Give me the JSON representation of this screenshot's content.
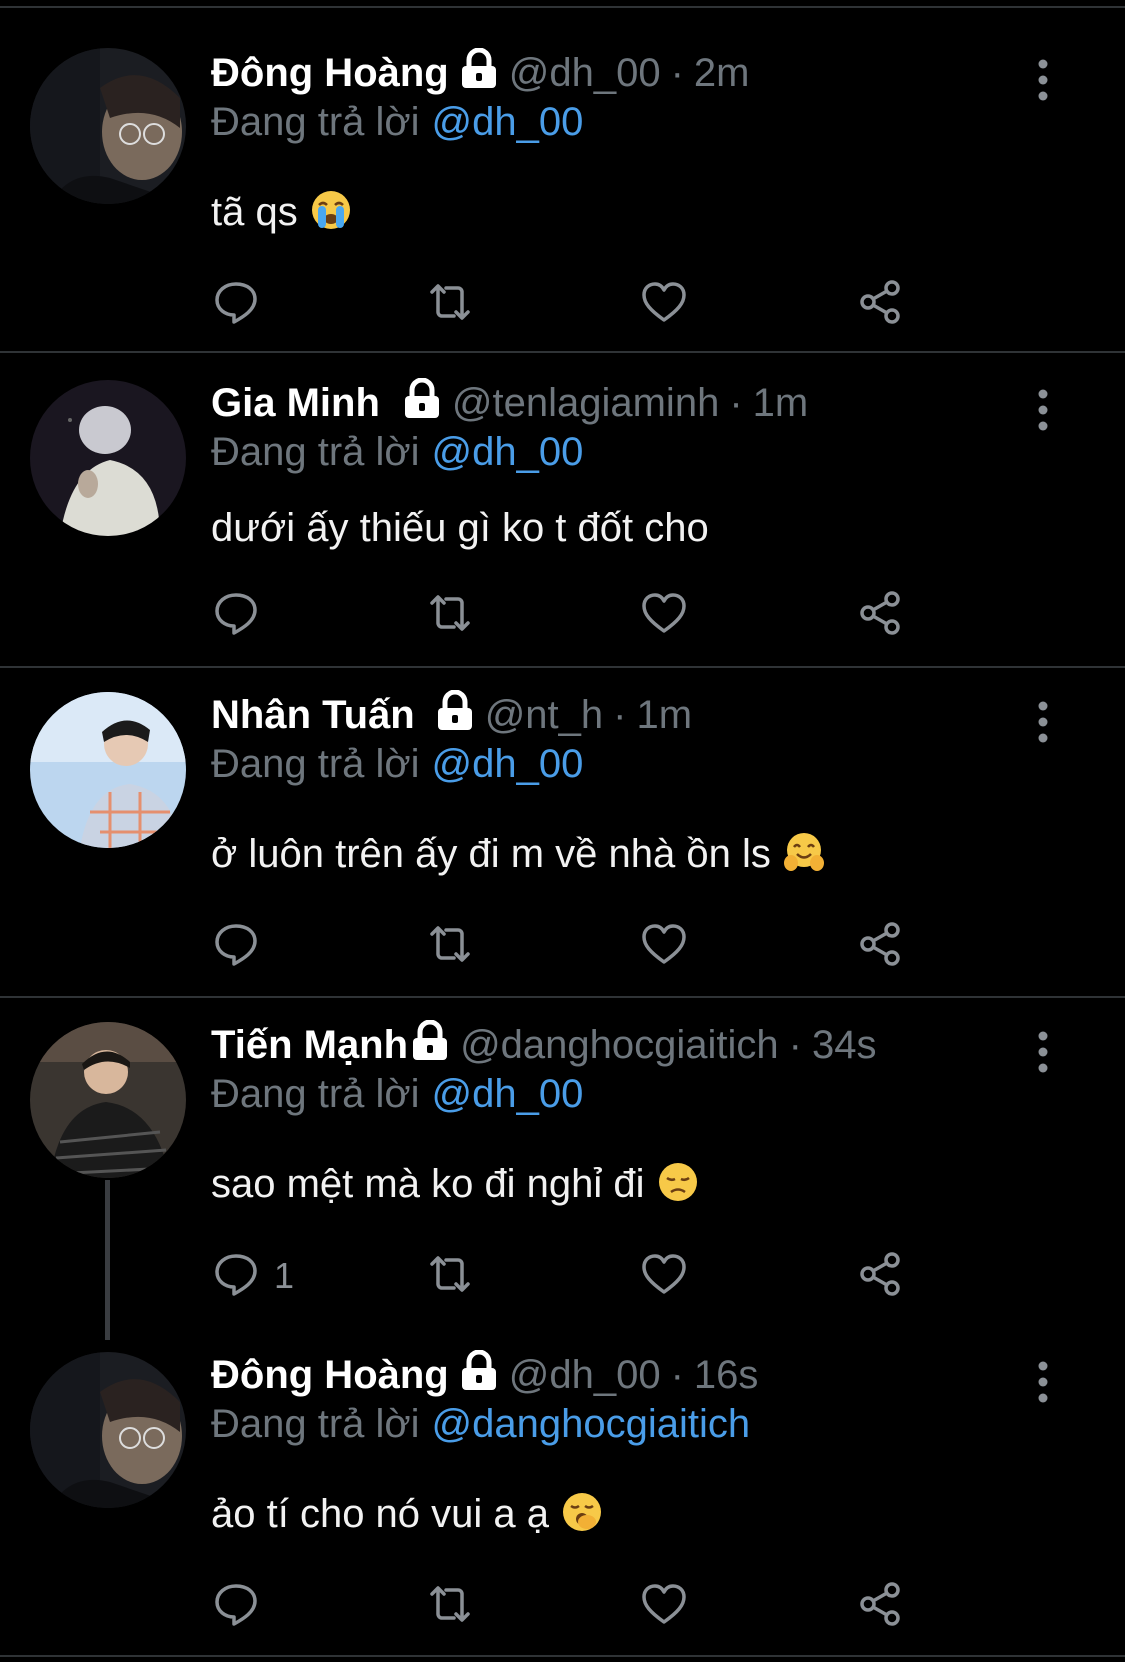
{
  "reply_label": "Đang trả lời",
  "colors": {
    "background": "#000000",
    "mention": "#4a9de8",
    "muted": "#6e767d",
    "divider": "#2f3336"
  },
  "tweets": [
    {
      "name": "Đông Hoàng",
      "handle": "@dh_00",
      "time": "2m",
      "replying_to": "@dh_00",
      "text": "tã qs",
      "emoji": "loudly-crying-face",
      "reply_count": "",
      "avatar": "photo-man-glasses-dark"
    },
    {
      "name": "Gia Minh",
      "handle": "@tenlagiaminh",
      "time": "1m",
      "replying_to": "@dh_00",
      "text": "dưới ấy thiếu gì ko t đốt cho",
      "emoji": "",
      "reply_count": "",
      "avatar": "photo-silver-hair-profile"
    },
    {
      "name": "Nhân Tuấn",
      "handle": "@nt_h",
      "time": "1m",
      "replying_to": "@dh_00",
      "text": "ở luôn trên ấy đi m về nhà ồn ls",
      "emoji": "hugging-face",
      "reply_count": "",
      "avatar": "photo-man-sky-plaid"
    },
    {
      "name": "Tiến Mạnh",
      "handle": "@danghocgiaitich",
      "time": "34s",
      "replying_to": "@dh_00",
      "text": "sao mệt mà ko đi nghỉ đi",
      "emoji": "disappointed-face",
      "reply_count": "1",
      "avatar": "photo-man-striped-shirt"
    },
    {
      "name": "Đông Hoàng",
      "handle": "@dh_00",
      "time": "16s",
      "replying_to": "@danghocgiaitich",
      "text": "ảo tí cho nó vui a ạ",
      "emoji": "yawning-face",
      "reply_count": "",
      "avatar": "photo-man-glasses-dark"
    }
  ],
  "icons": [
    "lock-icon",
    "more-icon",
    "reply-icon",
    "retweet-icon",
    "like-icon",
    "share-icon"
  ]
}
